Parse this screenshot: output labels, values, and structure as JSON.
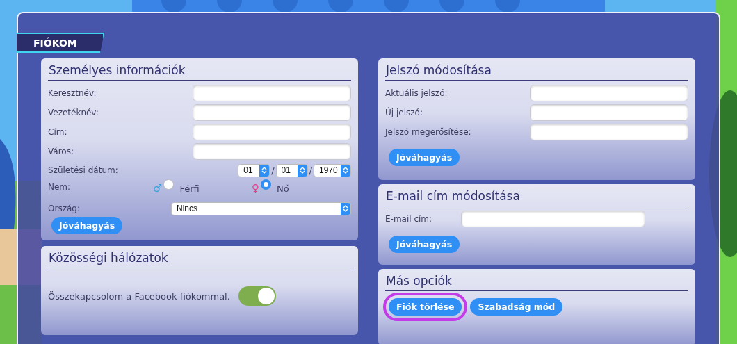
{
  "tab": {
    "label": "FIÓKOM"
  },
  "personal": {
    "title": "Személyes információk",
    "fields": [
      {
        "label": "Keresztnév:"
      },
      {
        "label": "Vezetéknév:"
      },
      {
        "label": "Cím:"
      },
      {
        "label": "Város:"
      }
    ],
    "birth_date": {
      "label": "Születési dátum:",
      "parts": [
        "01",
        "01",
        "1970"
      ],
      "separator": "/"
    },
    "gender": {
      "label": "Nem:",
      "options": [
        {
          "symbol": "♂",
          "label": "Férfi",
          "color": "#3aa0d8",
          "selected": false
        },
        {
          "symbol": "♀",
          "label": "Nő",
          "color": "#e0408a",
          "selected": true
        }
      ]
    },
    "country": {
      "label": "Ország:",
      "value": "Nincs"
    },
    "button": "Jóváhagyás"
  },
  "social": {
    "title": "Közösségi hálózatok",
    "label": "Összekapcsolom a Facebook fiókommal.",
    "on": true
  },
  "password": {
    "title": "Jelszó módosítása",
    "fields": [
      {
        "label": "Aktuális jelszó:"
      },
      {
        "label": "Új jelszó:"
      },
      {
        "label": "Jelszó megerősítése:"
      }
    ],
    "button": "Jóváhagyás"
  },
  "email": {
    "title": "E-mail cím módosítása",
    "fields": [
      {
        "label": "E-mail cím:"
      }
    ],
    "button": "Jóváhagyás"
  },
  "other": {
    "title": "Más opciók",
    "buttons": [
      {
        "label": "Fiók törlése",
        "highlighted": true
      },
      {
        "label": "Szabadság mód",
        "highlighted": false
      }
    ]
  }
}
